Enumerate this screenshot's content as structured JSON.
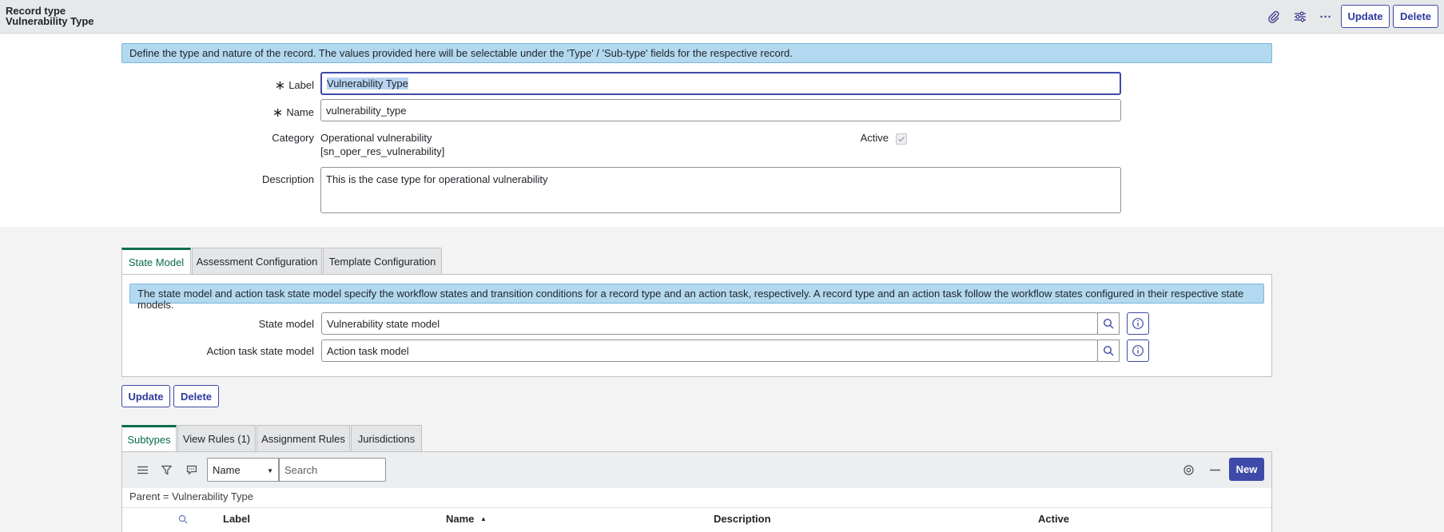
{
  "header": {
    "line1": "Record type",
    "line2": "Vulnerability Type",
    "update_label": "Update",
    "delete_label": "Delete"
  },
  "form": {
    "info_text": "Define the type and nature of the record. The values provided here will be selectable under the 'Type' / 'Sub-type' fields for the respective record.",
    "required_mark": "∗",
    "label_label": "Label",
    "label_value": "Vulnerability Type",
    "name_label": "Name",
    "name_value": "vulnerability_type",
    "category_label": "Category",
    "category_value_line1": "Operational vulnerability",
    "category_value_line2": "[sn_oper_res_vulnerability]",
    "active_label": "Active",
    "description_label": "Description",
    "description_value": "This is the case type for operational vulnerability"
  },
  "tabs1": {
    "items": [
      "State Model",
      "Assessment Configuration",
      "Template Configuration"
    ],
    "info_text": "The state model and action task state model specify the workflow states and transition conditions for a record type and an action task, respectively. A record type and an action task follow the workflow states configured in their respective state models.",
    "state_model_label": "State model",
    "state_model_value": "Vulnerability state model",
    "action_task_label": "Action task state model",
    "action_task_value": "Action task model"
  },
  "bottom_buttons": {
    "update_label": "Update",
    "delete_label": "Delete"
  },
  "tabs2": {
    "items": [
      "Subtypes",
      "View Rules (1)",
      "Assignment Rules",
      "Jurisdictions"
    ]
  },
  "list": {
    "field_select": "Name",
    "search_placeholder": "Search",
    "new_label": "New",
    "breadcrumb": "Parent = Vulnerability Type",
    "columns": [
      "Label",
      "Name",
      "Description",
      "Active"
    ]
  },
  "colors": {
    "accent": "#3f4aa8",
    "tab_active": "#0a6c4f",
    "info_bg": "#b3d9f0"
  }
}
